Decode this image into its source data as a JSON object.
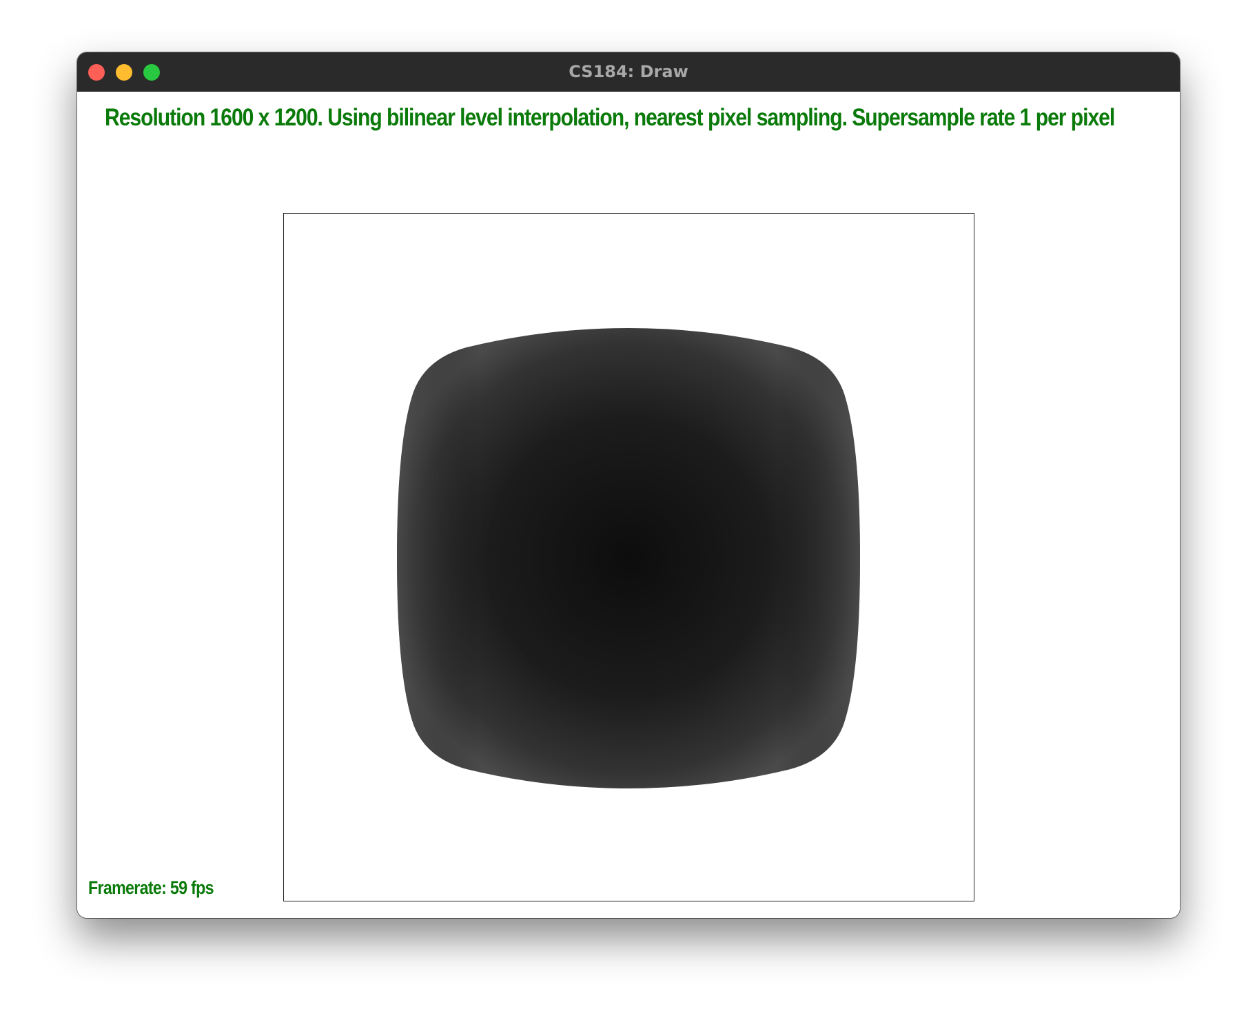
{
  "window": {
    "title": "CS184: Draw"
  },
  "status": {
    "info_line": "Resolution 1600 x 1200. Using bilinear level interpolation, nearest pixel sampling. Supersample rate 1 per pixel",
    "framerate": "Framerate: 59 fps"
  },
  "colors": {
    "status_text": "#0a7a0a",
    "titlebar": "#2a2a2a",
    "close": "#fe5f57",
    "minimize": "#febc2e",
    "maximize": "#28c840"
  },
  "icons": {
    "close": "close-icon",
    "minimize": "minimize-icon",
    "maximize": "maximize-icon"
  }
}
